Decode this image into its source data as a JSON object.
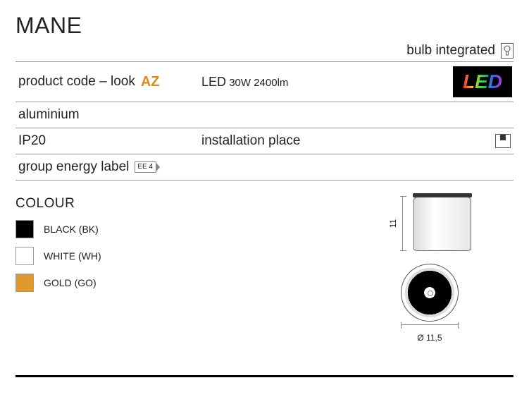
{
  "title": "MANE",
  "bulb_integrated": "bulb integrated",
  "spec": {
    "row1": {
      "left_label": "product code – look",
      "left_az": "AZ",
      "right_led": "LED",
      "right_spec": "30W 2400lm",
      "led_badge": "LED"
    },
    "row2": {
      "left": "aluminium"
    },
    "row3": {
      "left": "IP20",
      "right": "installation place"
    },
    "row4": {
      "left": "group energy label",
      "ee": "EE 4"
    }
  },
  "colour": {
    "title": "COLOUR",
    "items": [
      {
        "label": "BLACK (BK)",
        "swatch": "black"
      },
      {
        "label": "WHITE (WH)",
        "swatch": "white"
      },
      {
        "label": "GOLD (GO)",
        "swatch": "gold"
      }
    ]
  },
  "dimensions": {
    "height": "11",
    "diameter": "Ø 11,5"
  }
}
